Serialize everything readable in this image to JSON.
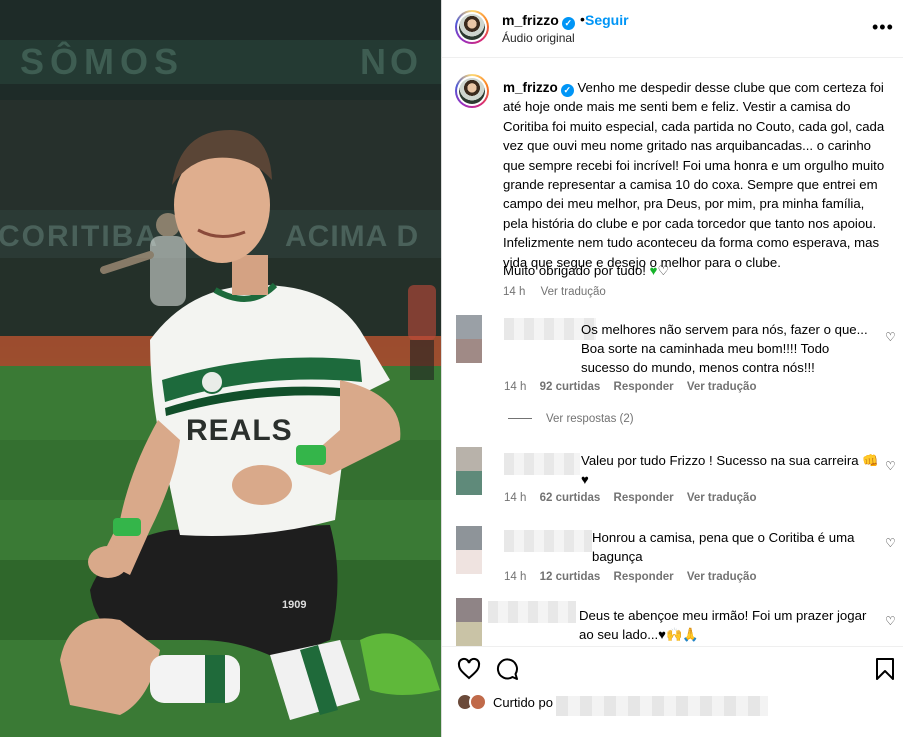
{
  "media": {
    "banner_top": "SÔMOS",
    "banner_top_right": "NO",
    "banner_mid": "CORITIBA",
    "banner_mid_right": "ACIMA D",
    "shirt_sponsor": "REALS",
    "shorts_number": "1909"
  },
  "header": {
    "username": "m_frizzo",
    "separator": "•",
    "follow_label": "Seguir",
    "audio_label": "Áudio original",
    "more_icon": "more-icon"
  },
  "caption": {
    "username": "m_frizzo",
    "text": "Venho me despedir desse clube que com certeza foi até hoje onde mais me senti bem e feliz. Vestir a camisa do Coritiba foi muito especial, cada partida no Couto, cada gol, cada vez que ouvi meu nome gritado nas arquibancadas... o carinho que sempre recebi foi incrível! Foi uma honra e um orgulho muito grande representar a camisa 10 do coxa. Sempre que entrei em campo dei meu melhor, pra Deus, por mim, pra minha família, pela história do clube e por cada torcedor que tanto nos apoiou. Infelizmente nem tudo aconteceu da forma como esperava, mas vida que segue e desejo o melhor para o clube.",
    "thanks": "Muito obrigado por tudo!",
    "thanks_emoji_1": "♥",
    "thanks_emoji_2": "♡",
    "time": "14 h",
    "translate": "Ver tradução"
  },
  "comments": [
    {
      "text": "Os melhores não servem para nós, fazer o que... Boa sorte na caminhada meu bom!!!! Todo sucesso do mundo, menos contra nós!!!",
      "time": "14 h",
      "likes": "92 curtidas",
      "reply": "Responder",
      "translate": "Ver tradução",
      "view_replies": "Ver respostas (2)",
      "colors": [
        "#9aa0a6",
        "#a08a86"
      ]
    },
    {
      "text": "Valeu por tudo Frizzo ! Sucesso na sua carreira 👊 ♥",
      "time": "14 h",
      "likes": "62 curtidas",
      "reply": "Responder",
      "translate": "Ver tradução",
      "colors": [
        "#b8b2aa",
        "#5f8a7a"
      ]
    },
    {
      "text": "Honrou a camisa, pena que o Coritiba é uma bagunça",
      "time": "14 h",
      "likes": "12 curtidas",
      "reply": "Responder",
      "translate": "Ver tradução",
      "colors": [
        "#8e9499",
        "#efe3e0"
      ]
    },
    {
      "text": "Deus te abençoe meu irmão! Foi um prazer jogar ao seu lado...♥🙌🙏",
      "colors": [
        "#8f8486",
        "#c9c3a6"
      ]
    }
  ],
  "actions": {
    "like_icon": "heart-outline-icon",
    "comment_icon": "comment-bubble-icon",
    "save_icon": "bookmark-icon"
  },
  "liked_by": {
    "label": "Curtido po"
  },
  "colors": {
    "link_blue": "#0095f6",
    "meta_gray": "#737373",
    "border": "#dbdbdb",
    "heart_green": "#16b32a"
  }
}
